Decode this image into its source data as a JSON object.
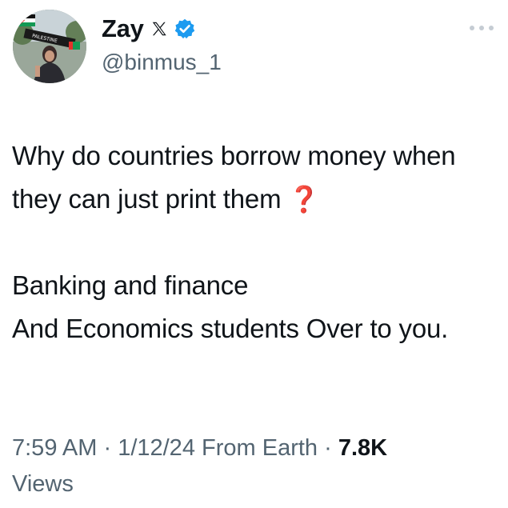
{
  "author": {
    "display_name": "Zay",
    "handle": "@binmus_1",
    "avatar_banner_text": "PALESTINE",
    "verified": true
  },
  "tweet": {
    "line1": "Why do countries borrow money when they can just print them ",
    "question_emoji": "❓",
    "line2": "Banking and finance\nAnd Economics students Over to you."
  },
  "meta": {
    "time": "7:59 AM",
    "separator1": " · ",
    "date": "1/12/24",
    "source": " From Earth",
    "separator2": " · ",
    "views_count": "7.8K",
    "views_label": " Views"
  },
  "colors": {
    "verified_blue": "#1d9bf0",
    "text_primary": "#0f1419",
    "text_secondary": "#536471",
    "question_red": "#e0201f"
  },
  "icons": {
    "x_logo": "x-logo-icon",
    "verified": "verified-badge-icon",
    "more": "more-options-icon"
  }
}
